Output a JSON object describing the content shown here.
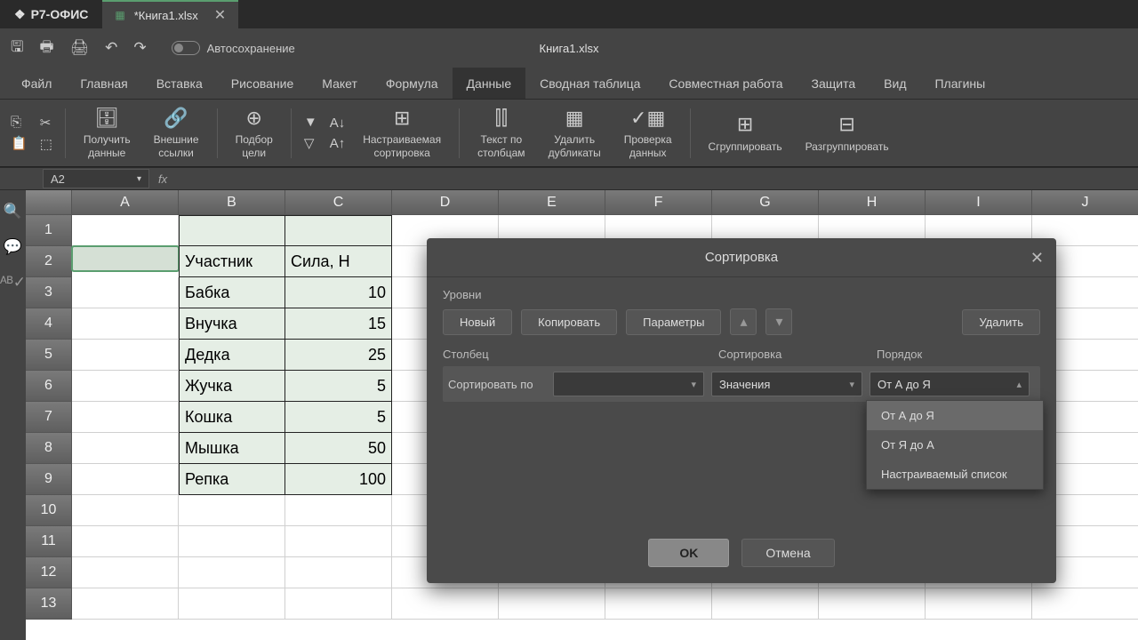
{
  "app": {
    "name": "Р7-ОФИС"
  },
  "tab": {
    "filename": "*Книга1.xlsx"
  },
  "doc_title": "Книга1.xlsx",
  "autosave_label": "Автосохранение",
  "menu": [
    "Файл",
    "Главная",
    "Вставка",
    "Рисование",
    "Макет",
    "Формула",
    "Данные",
    "Сводная таблица",
    "Совместная работа",
    "Защита",
    "Вид",
    "Плагины"
  ],
  "active_menu": 6,
  "ribbon": {
    "get_data": "Получить\nданные",
    "ext_links": "Внешние\nссылки",
    "goal_seek": "Подбор\nцели",
    "custom_sort": "Настраиваемая\nсортировка",
    "text_cols": "Текст по\nстолбцам",
    "rem_dup": "Удалить\nдубликаты",
    "data_val": "Проверка\nданных",
    "group": "Сгруппировать",
    "ungroup": "Разгруппировать"
  },
  "cellref": "A2",
  "columns": [
    "A",
    "B",
    "C",
    "D",
    "E",
    "F",
    "G",
    "H",
    "I",
    "J"
  ],
  "table": {
    "headers": [
      "Участник",
      "Сила, Н"
    ],
    "rows": [
      [
        "Бабка",
        "10"
      ],
      [
        "Внучка",
        "15"
      ],
      [
        "Дедка",
        "25"
      ],
      [
        "Жучка",
        "5"
      ],
      [
        "Кошка",
        "5"
      ],
      [
        "Мышка",
        "50"
      ],
      [
        "Репка",
        "100"
      ]
    ]
  },
  "dialog": {
    "title": "Сортировка",
    "levels": "Уровни",
    "new": "Новый",
    "copy": "Копировать",
    "params": "Параметры",
    "delete": "Удалить",
    "col_label": "Столбец",
    "sort_label": "Сортировка",
    "order_label": "Порядок",
    "sort_by": "Сортировать по",
    "sort_val": "Значения",
    "order_val": "От А до Я",
    "ok": "OK",
    "cancel": "Отмена"
  },
  "dropdown": {
    "items": [
      "От А до Я",
      "От Я до А",
      "Настраиваемый список"
    ]
  }
}
